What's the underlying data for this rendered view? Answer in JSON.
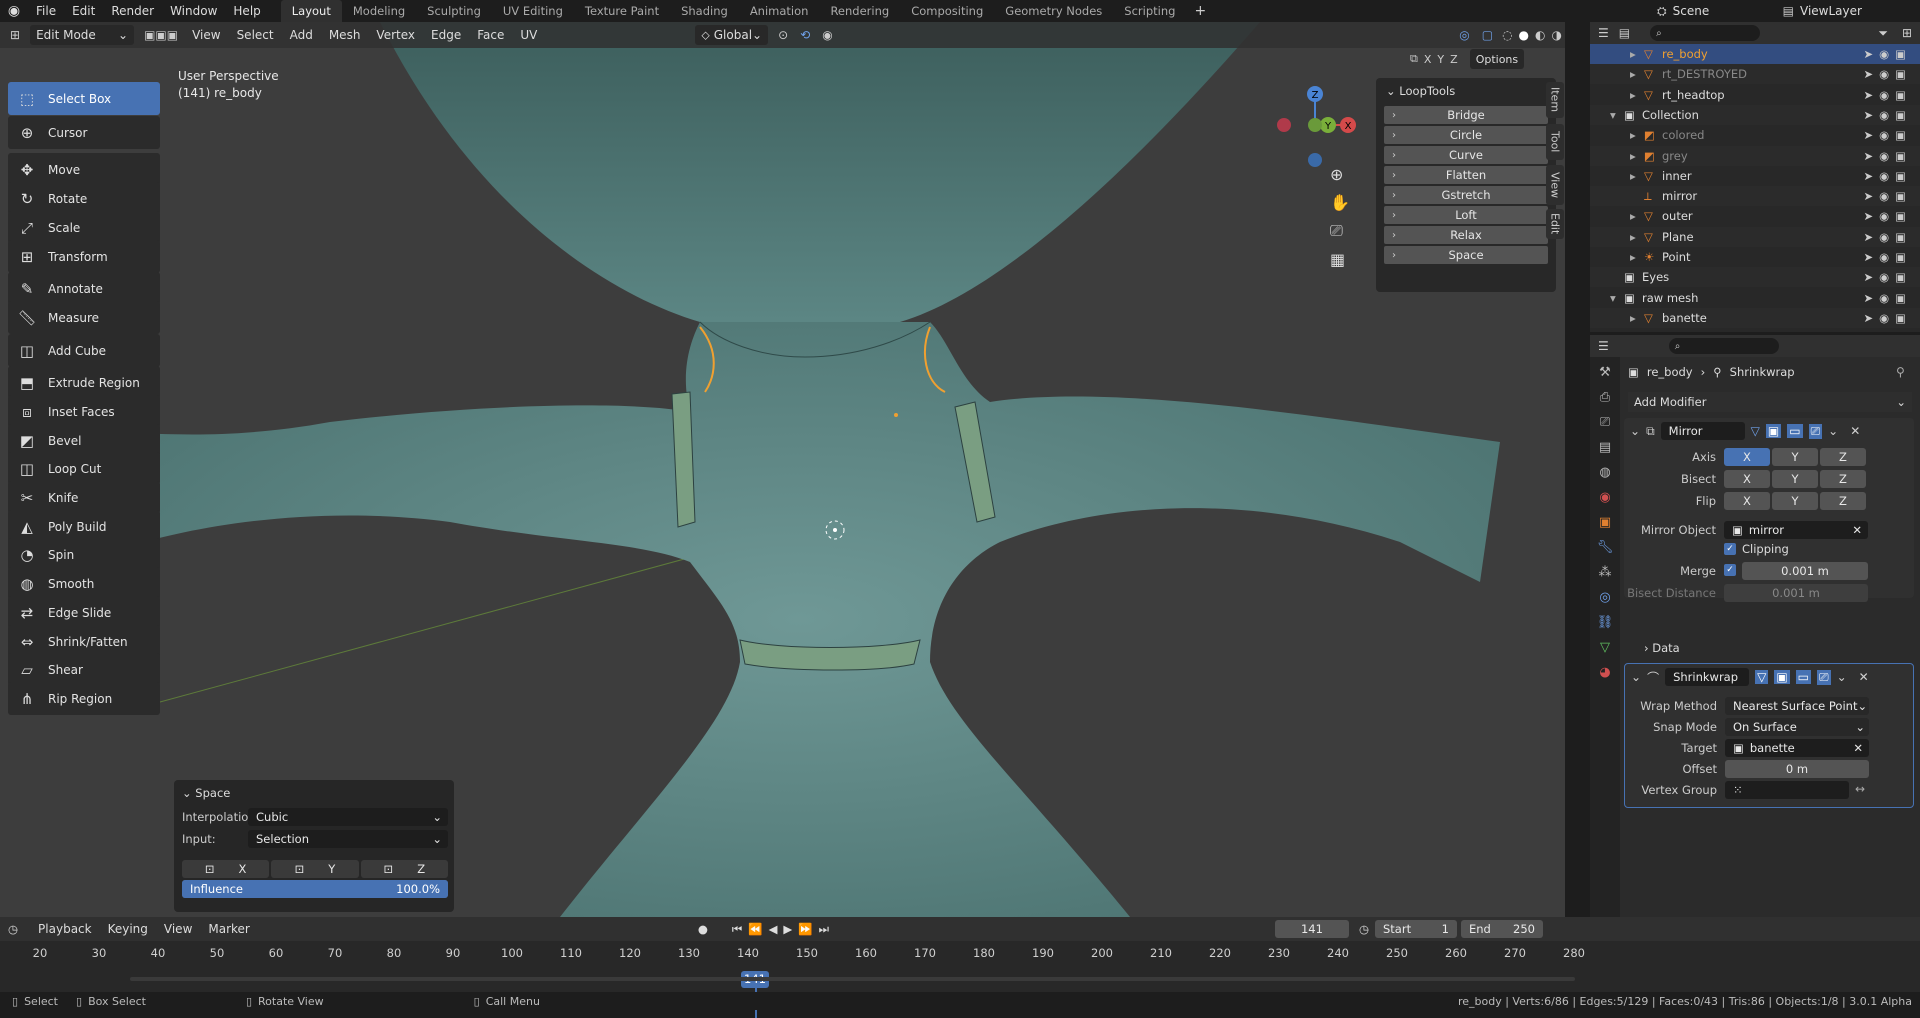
{
  "top_menu": {
    "items": [
      "File",
      "Edit",
      "Render",
      "Window",
      "Help"
    ]
  },
  "workspaces": [
    "Layout",
    "Modeling",
    "Sculpting",
    "UV Editing",
    "Texture Paint",
    "Shading",
    "Animation",
    "Rendering",
    "Compositing",
    "Geometry Nodes",
    "Scripting"
  ],
  "active_workspace": "Layout",
  "scene_name": "Scene",
  "view_layer": "ViewLayer",
  "viewport_header": {
    "mode": "Edit Mode",
    "menus": [
      "View",
      "Select",
      "Add",
      "Mesh",
      "Vertex",
      "Edge",
      "Face",
      "UV"
    ],
    "orientation": "Global",
    "options": "Options",
    "axes": [
      "X",
      "Y",
      "Z"
    ]
  },
  "viewport_info": {
    "line1": "User Perspective",
    "line2": "(141) re_body"
  },
  "tools": [
    {
      "label": "Select Box",
      "icon": "select-box-icon",
      "active": true
    },
    {
      "label": "Cursor",
      "icon": "cursor-icon"
    },
    {
      "label": "Move",
      "icon": "move-icon"
    },
    {
      "label": "Rotate",
      "icon": "rotate-icon"
    },
    {
      "label": "Scale",
      "icon": "scale-icon"
    },
    {
      "label": "Transform",
      "icon": "transform-icon"
    },
    {
      "label": "Annotate",
      "icon": "annotate-icon"
    },
    {
      "label": "Measure",
      "icon": "measure-icon"
    },
    {
      "label": "Add Cube",
      "icon": "add-cube-icon"
    },
    {
      "label": "Extrude Region",
      "icon": "extrude-icon"
    },
    {
      "label": "Inset Faces",
      "icon": "inset-icon"
    },
    {
      "label": "Bevel",
      "icon": "bevel-icon"
    },
    {
      "label": "Loop Cut",
      "icon": "loop-cut-icon"
    },
    {
      "label": "Knife",
      "icon": "knife-icon"
    },
    {
      "label": "Poly Build",
      "icon": "poly-build-icon"
    },
    {
      "label": "Spin",
      "icon": "spin-icon"
    },
    {
      "label": "Smooth",
      "icon": "smooth-icon"
    },
    {
      "label": "Edge Slide",
      "icon": "edge-slide-icon"
    },
    {
      "label": "Shrink/Fatten",
      "icon": "shrink-fatten-icon"
    },
    {
      "label": "Shear",
      "icon": "shear-icon"
    },
    {
      "label": "Rip Region",
      "icon": "rip-icon"
    }
  ],
  "looptools": {
    "title": "LoopTools",
    "items": [
      "Bridge",
      "Circle",
      "Curve",
      "Flatten",
      "Gstretch",
      "Loft",
      "Relax",
      "Space"
    ]
  },
  "side_tabs": [
    "Item",
    "Tool",
    "View",
    "Edit"
  ],
  "operator_panel": {
    "title": "Space",
    "interp_label": "Interpolatio...",
    "interp_value": "Cubic",
    "input_label": "Input:",
    "input_value": "Selection",
    "axes": [
      "X",
      "Y",
      "Z"
    ],
    "influence_label": "Influence",
    "influence_value": "100.0%",
    "influence_fraction": 1.0
  },
  "outliner": {
    "rows": [
      {
        "name": "re_body",
        "indent": 1,
        "icon": "mesh-icon",
        "selected": true,
        "expander": "▸"
      },
      {
        "name": "rt_DESTROYED",
        "indent": 1,
        "icon": "mesh-icon",
        "dim": true,
        "expander": "▸"
      },
      {
        "name": "rt_headtop",
        "indent": 1,
        "icon": "mesh-icon",
        "expander": "▸"
      },
      {
        "name": "Collection",
        "indent": 0,
        "icon": "collection-icon",
        "expander": "▾"
      },
      {
        "name": "colored",
        "indent": 1,
        "icon": "image-icon",
        "dim": true,
        "expander": "▸"
      },
      {
        "name": "grey",
        "indent": 1,
        "icon": "image-icon",
        "dim": true,
        "expander": "▸"
      },
      {
        "name": "inner",
        "indent": 1,
        "icon": "mesh-icon",
        "expander": "▸"
      },
      {
        "name": "mirror",
        "indent": 1,
        "icon": "empty-icon",
        "expander": ""
      },
      {
        "name": "outer",
        "indent": 1,
        "icon": "mesh-icon",
        "expander": "▸"
      },
      {
        "name": "Plane",
        "indent": 1,
        "icon": "mesh-icon",
        "expander": "▸"
      },
      {
        "name": "Point",
        "indent": 1,
        "icon": "light-icon",
        "expander": "▸"
      },
      {
        "name": "Eyes",
        "indent": 0,
        "icon": "collection-icon",
        "expander": ""
      },
      {
        "name": "raw mesh",
        "indent": 0,
        "icon": "collection-icon",
        "expander": "▾"
      },
      {
        "name": "banette",
        "indent": 1,
        "icon": "mesh-icon",
        "expander": "▸"
      }
    ]
  },
  "properties": {
    "breadcrumb_object": "re_body",
    "breadcrumb_modifier": "Shrinkwrap",
    "add_modifier": "Add Modifier",
    "mirror": {
      "name": "Mirror",
      "axis_label": "Axis",
      "bisect_label": "Bisect",
      "flip_label": "Flip",
      "axes": [
        "X",
        "Y",
        "Z"
      ],
      "mirror_object_label": "Mirror Object",
      "mirror_object": "mirror",
      "clipping_label": "Clipping",
      "merge_label": "Merge",
      "merge_value": "0.001 m",
      "bisect_distance_label": "Bisect Distance",
      "bisect_distance": "0.001 m",
      "data_label": "Data"
    },
    "shrinkwrap": {
      "name": "Shrinkwrap",
      "wrap_method_label": "Wrap Method",
      "wrap_method": "Nearest Surface Point",
      "snap_mode_label": "Snap Mode",
      "snap_mode": "On Surface",
      "target_label": "Target",
      "target": "banette",
      "offset_label": "Offset",
      "offset": "0 m",
      "vertex_group_label": "Vertex Group"
    }
  },
  "timeline": {
    "menus": [
      "Playback",
      "Keying",
      "View",
      "Marker"
    ],
    "current_frame": "141",
    "start_label": "Start",
    "start": "1",
    "end_label": "End",
    "end": "250",
    "ticks": [
      "20",
      "30",
      "40",
      "50",
      "60",
      "70",
      "80",
      "90",
      "100",
      "110",
      "120",
      "130",
      "140",
      "150",
      "160",
      "170",
      "180",
      "190",
      "200",
      "210",
      "220",
      "230",
      "240",
      "250",
      "260",
      "270",
      "280"
    ]
  },
  "statusbar": {
    "select": "Select",
    "box_select": "Box Select",
    "rotate_view": "Rotate View",
    "call_menu": "Call Menu",
    "stats": "re_body | Verts:6/86 | Edges:5/129 | Faces:0/43 | Tris:86 | Objects:1/8 | 3.0.1 Alpha"
  },
  "colors": {
    "accent": "#4772b3",
    "mesh": "#5e8a88",
    "selection": "#f0a030",
    "bg": "#3d3d3d"
  }
}
